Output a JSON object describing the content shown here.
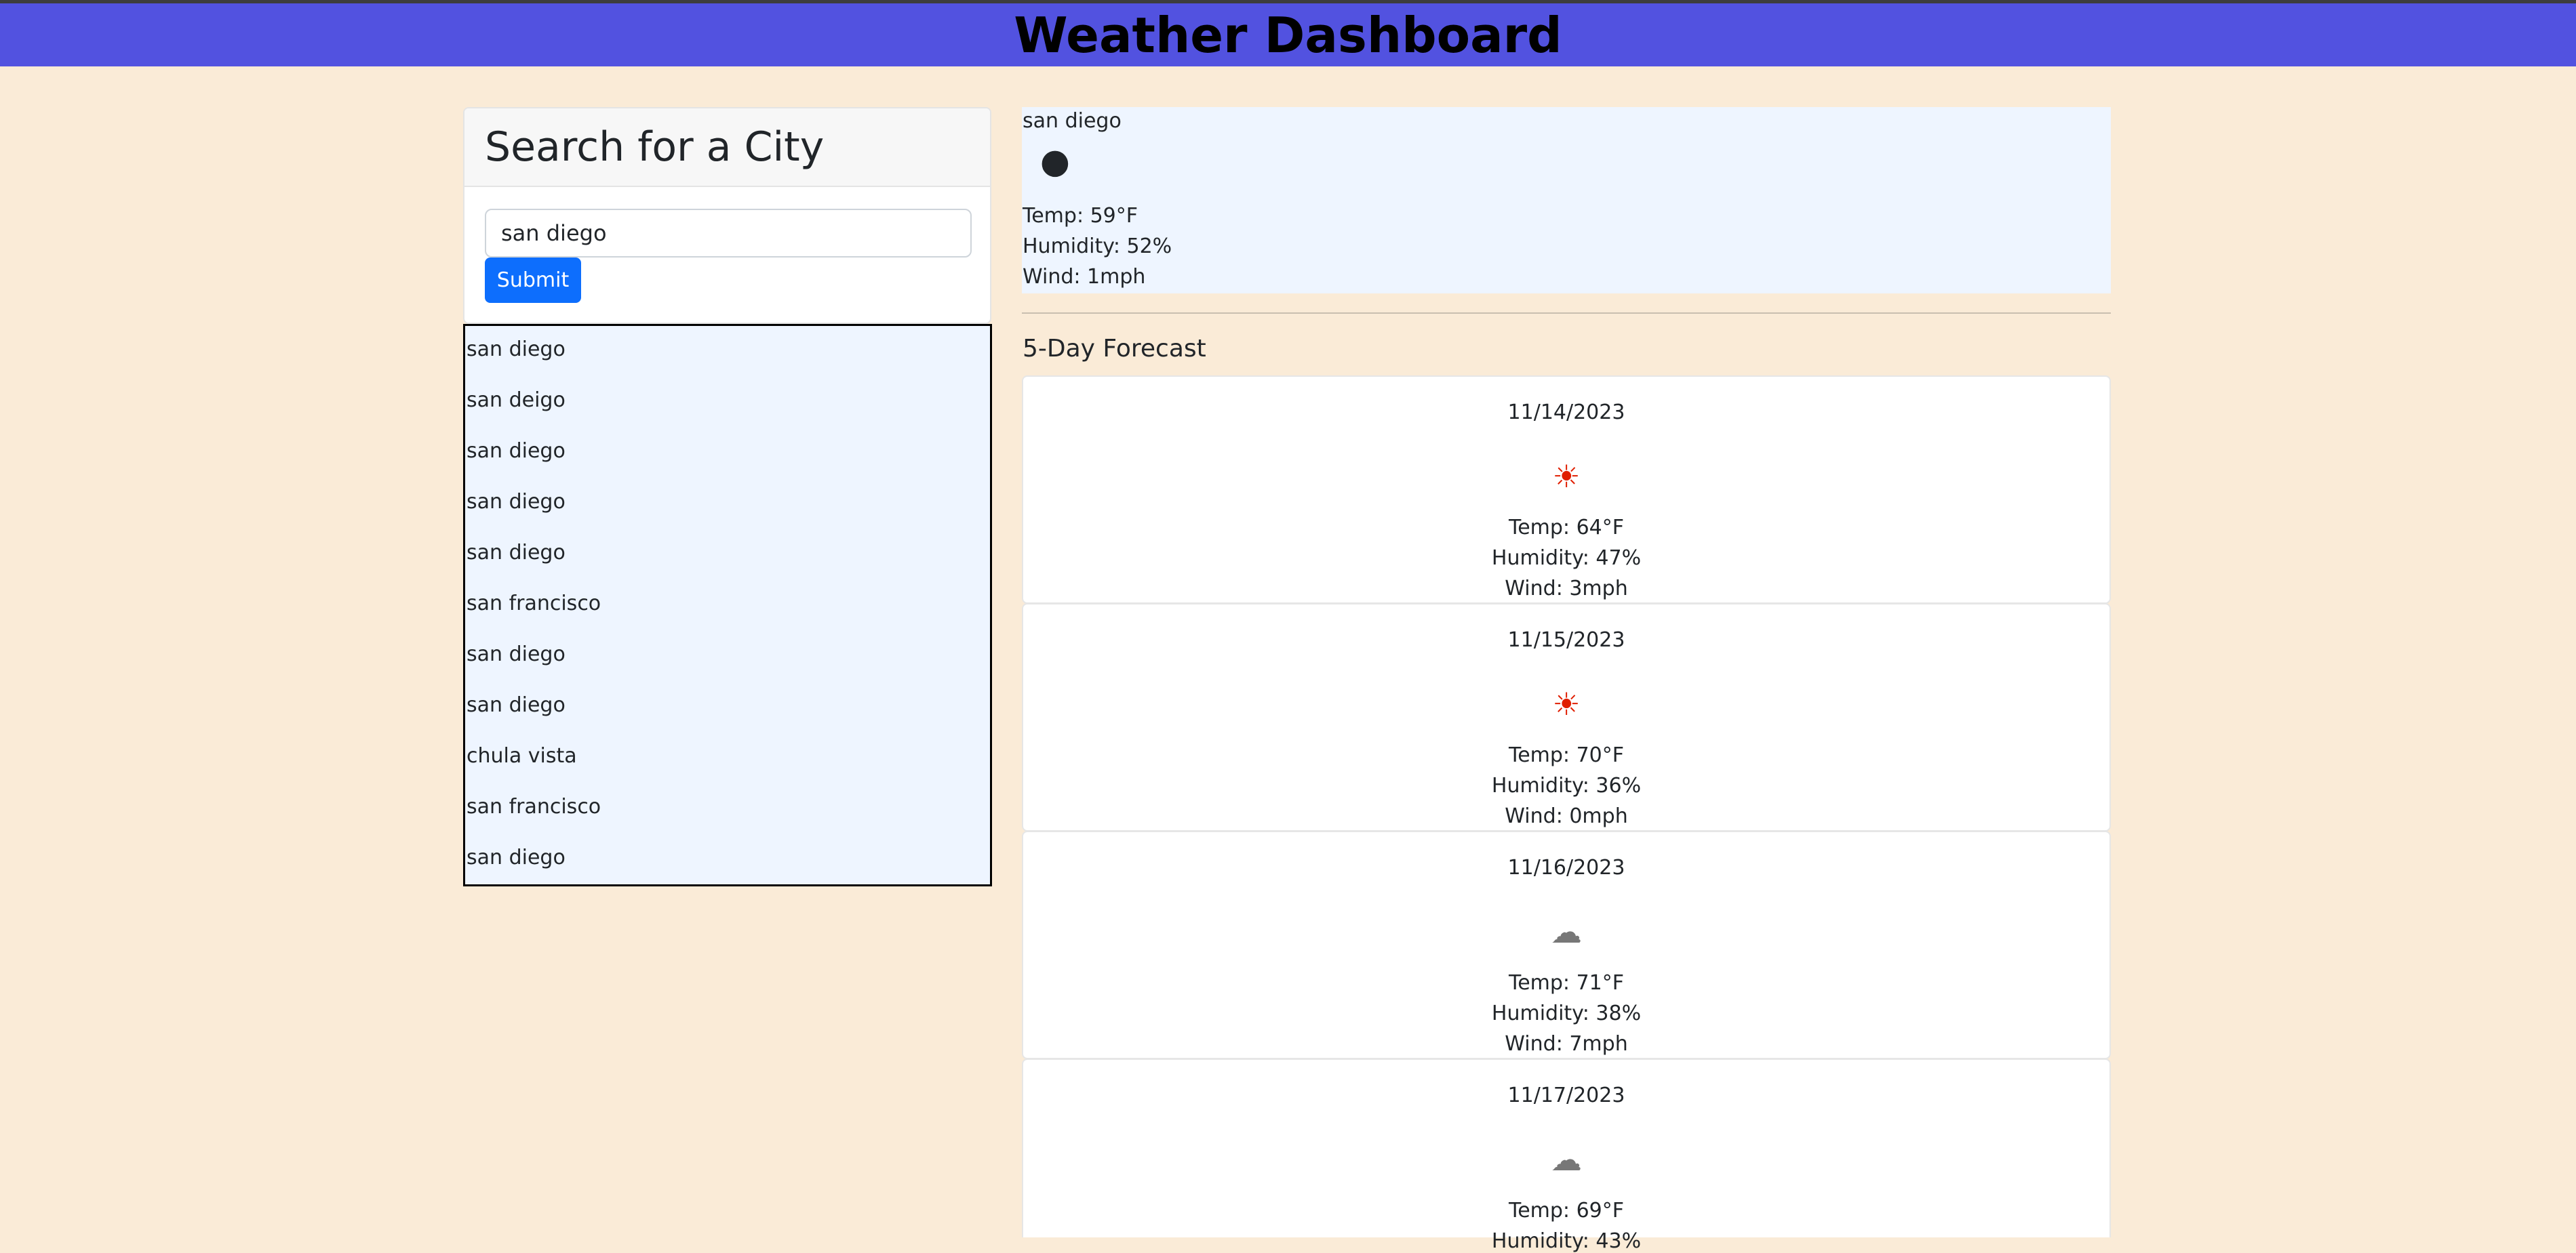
{
  "header": {
    "title": "Weather Dashboard"
  },
  "search": {
    "title": "Search for a City",
    "input_value": "san diego",
    "submit_label": "Submit"
  },
  "history": [
    "san diego",
    "san deigo",
    "san diego",
    "san diego",
    "san diego",
    "san francisco",
    "san diego",
    "san diego",
    "chula vista",
    "san francisco",
    "san diego"
  ],
  "current": {
    "city": "san diego",
    "icon": "🌑",
    "icon_name": "moon-clouds-icon",
    "temp": "Temp: 59°F",
    "humidity": "Humidity: 52%",
    "wind": "Wind: 1mph"
  },
  "forecast": {
    "title": "5-Day Forecast",
    "days": [
      {
        "date": "11/14/2023",
        "icon": "☀",
        "icon_name": "sun-icon",
        "temp": "Temp: 64°F",
        "humidity": "Humidity: 47%",
        "wind": "Wind: 3mph"
      },
      {
        "date": "11/15/2023",
        "icon": "☀",
        "icon_name": "sun-icon",
        "temp": "Temp: 70°F",
        "humidity": "Humidity: 36%",
        "wind": "Wind: 0mph"
      },
      {
        "date": "11/16/2023",
        "icon": "☁",
        "icon_name": "cloud-icon",
        "temp": "Temp: 71°F",
        "humidity": "Humidity: 38%",
        "wind": "Wind: 7mph"
      },
      {
        "date": "11/17/2023",
        "icon": "☁",
        "icon_name": "cloud-icon",
        "temp": "Temp: 69°F",
        "humidity": "Humidity: 43%",
        "wind": ""
      }
    ]
  },
  "colors": {
    "header_bg": "#5252e0",
    "page_bg": "#faebd7",
    "accent": "#0d6efd",
    "panel_bg": "#eef5ff"
  }
}
